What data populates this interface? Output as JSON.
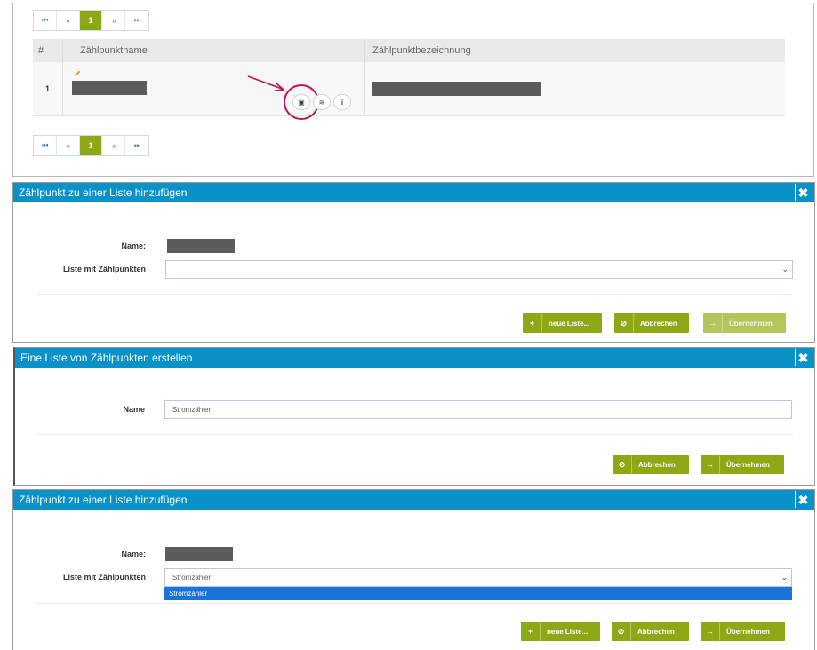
{
  "pagination": {
    "first": "⏮",
    "prev": "«",
    "page": "1",
    "next": "»",
    "last": "⏭"
  },
  "table": {
    "headers": [
      "#",
      "Zählpunktname",
      "Zählpunktbezeichnung"
    ],
    "rows": [
      {
        "num": "1"
      }
    ]
  },
  "dialog_add": {
    "title": "Zählpunkt zu einer Liste hinzufügen",
    "name_label": "Name:",
    "list_label": "Liste mit Zählpunkten",
    "list_value": "",
    "btn_new": "neue Liste...",
    "btn_cancel": "Abbrechen",
    "btn_apply": "Übernehmen"
  },
  "dialog_create": {
    "title": "Eine Liste von Zählpunkten erstellen",
    "name_label": "Name",
    "name_value": "Stromzähler",
    "btn_cancel": "Abbrechen",
    "btn_apply": "Übernehmen"
  },
  "dialog_add2": {
    "title": "Zählpunkt zu einer Liste hinzufügen",
    "name_label": "Name:",
    "list_label": "Liste mit Zählpunkten",
    "list_value": "Stromzähler",
    "option": "Stromzähler",
    "btn_new": "neue Liste...",
    "btn_cancel": "Abbrechen",
    "btn_apply": "Übernehmen"
  },
  "colors": {
    "accent": "#0a91c8",
    "button": "#8da815",
    "highlight": "#c0144a",
    "select": "#1a73d6"
  }
}
